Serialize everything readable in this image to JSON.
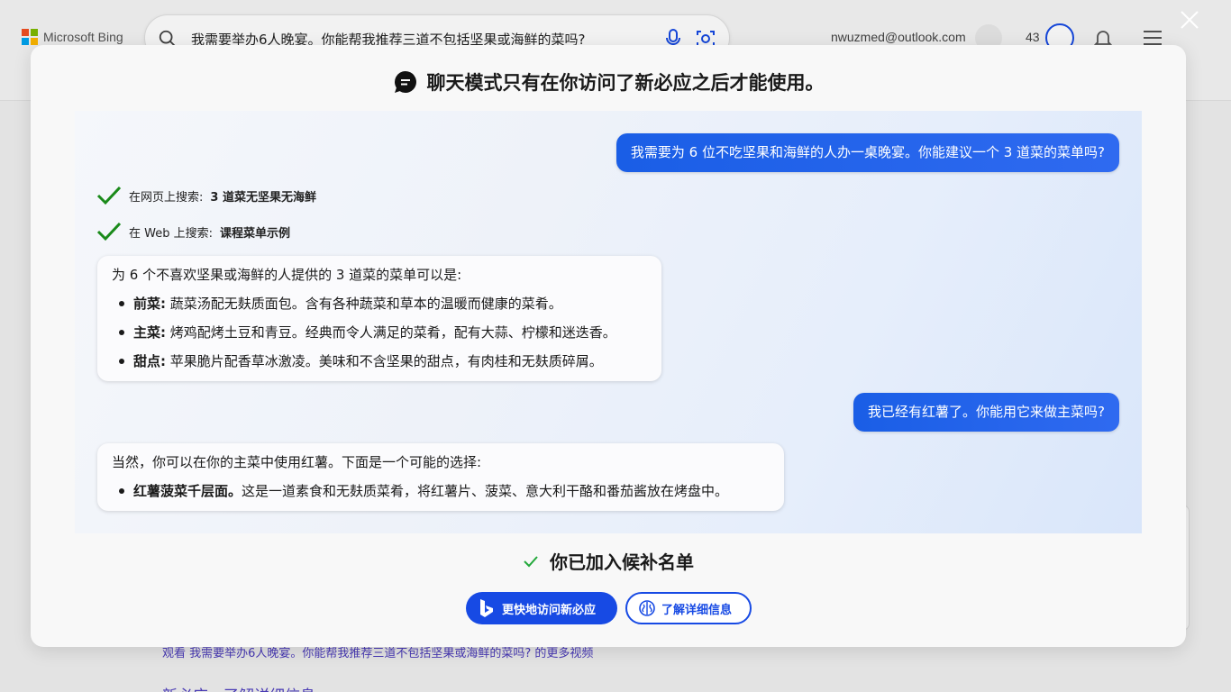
{
  "background": {
    "brand": "Microsoft Bing",
    "search_query": "我需要举办6人晚宴。你能帮我推荐三道不包括坚果或海鲜的菜吗?",
    "email": "nwuzmed@outlook.com",
    "points": "43",
    "link_videos": "观看 我需要举办6人晚宴。你能帮我推荐三道不包括坚果或海鲜的菜吗? 的更多视频",
    "link_learn": "新必应 - 了解详细信息"
  },
  "modal": {
    "title": "聊天模式只有在你访问了新必应之后才能使用。",
    "user_message_1": "我需要为 6 位不吃坚果和海鲜的人办一桌晚宴。你能建议一个 3 道菜的菜单吗?",
    "search_1": {
      "prefix": "在网页上搜索: ",
      "query": "3 道菜无坚果无海鲜"
    },
    "search_2": {
      "prefix": "在 Web 上搜索: ",
      "query": "课程菜单示例"
    },
    "bot_reply_1": {
      "intro": "为 6 个不喜欢坚果或海鲜的人提供的 3 道菜的菜单可以是:",
      "items": [
        {
          "label": "前菜:",
          "text": " 蔬菜汤配无麸质面包。含有各种蔬菜和草本的温暖而健康的菜肴。"
        },
        {
          "label": "主菜:",
          "text": " 烤鸡配烤土豆和青豆。经典而令人满足的菜肴，配有大蒜、柠檬和迷迭香。"
        },
        {
          "label": "甜点:",
          "text": " 苹果脆片配香草冰激凌。美味和不含坚果的甜点，有肉桂和无麸质碎屑。"
        }
      ]
    },
    "user_message_2": "我已经有红薯了。你能用它来做主菜吗?",
    "bot_reply_2": {
      "intro": "当然，你可以在你的主菜中使用红薯。下面是一个可能的选择:",
      "items": [
        {
          "label": "红薯菠菜千层面。",
          "text": "这是一道素食和无麸质菜肴，将红薯片、菠菜、意大利干酪和番茄酱放在烤盘中。"
        }
      ]
    },
    "waitlist_text": "你已加入候补名单",
    "primary_button": "更快地访问新必应",
    "secondary_button": "了解详细信息"
  },
  "colors": {
    "accent": "#174ae4",
    "user_bubble": "#1a5ee6",
    "check_green": "#1a8a1a"
  }
}
